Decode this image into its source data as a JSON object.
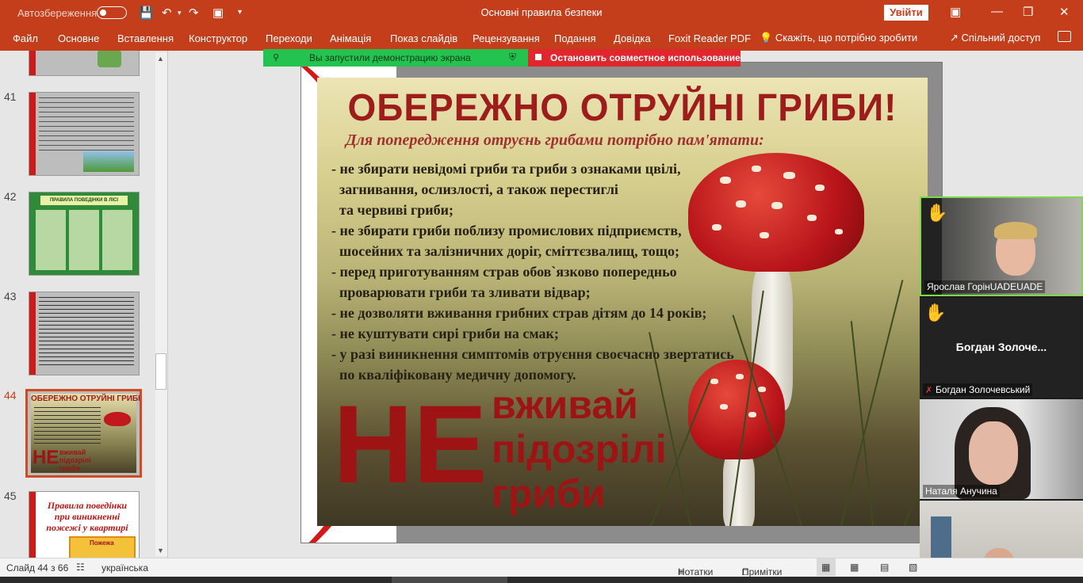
{
  "titlebar": {
    "autosave_label": "Автозбереження",
    "doc_title": "Основні правила безпеки",
    "signin_label": "Увійти"
  },
  "ribbon": {
    "tabs": [
      "Файл",
      "Основне",
      "Вставлення",
      "Конструктор",
      "Переходи",
      "Анімація",
      "Показ слайдів",
      "Рецензування",
      "Подання",
      "Довідка",
      "Foxit Reader PDF"
    ],
    "tell_me": "Скажіть, що потрібно зробити",
    "share": "Спільний доступ"
  },
  "share_notice": {
    "started": "Вы запустили демонстрацию экрана",
    "stop": "Остановить совместное использование"
  },
  "thumbnails": {
    "numbers": [
      "41",
      "42",
      "43",
      "44",
      "45"
    ],
    "active": "44",
    "slide44_title": "ОБЕРЕЖНО ОТРУЙНІ ГРИБИ!",
    "slide44_ne": "НЕ",
    "slide44_words": [
      "вживай",
      "підозрілі",
      "гриби"
    ],
    "slide42_title": "ПРАВИЛА ПОВЕДІНКИ В ЛІСІ",
    "slide45_title": "Правила поведінки при виникненні пожежі у квартирі",
    "slide45_badge": "Пожежа"
  },
  "slide": {
    "title": "ОБЕРЕЖНО ОТРУЙНІ ГРИБИ!",
    "subtitle": "Для попередження отруєнь грибами потрібно пам'ятати:",
    "lines": [
      "- не збирати невідомі гриби та гриби з ознаками цвілі,",
      "  загнивання, ослизлості, а також перестиглі",
      "  та червиві гриби;",
      "- не збирати гриби поблизу промислових  підприємств,",
      "  шосейних та залізничних доріг, сміттєзвалищ, тощо;",
      "- перед приготуванням страв обов`язково попередньо",
      "  проварювати гриби та зливати відвар;",
      "- не дозволяти вживання грибних страв дітям до 14 років;",
      "- не куштувати сирі гриби на смак;",
      "- у разі виникнення симптомів отруєння своєчасно звертатись",
      "  по кваліфіковану медичну допомогу."
    ],
    "ne": "НЕ",
    "ne_words": [
      "вживай",
      "підозрілі",
      "гриби"
    ]
  },
  "participants": [
    {
      "name": "Ярослав ГорінUADEUADE",
      "hand": true,
      "video": true
    },
    {
      "name": "Богдан Золочевський",
      "display": "Богдан  Золоче...",
      "hand": true,
      "video": false,
      "muted": true
    },
    {
      "name": "Наталя Анучина",
      "hand": false,
      "video": true
    },
    {
      "name": "",
      "hand": false,
      "video": true
    }
  ],
  "statusbar": {
    "slide_count": "Слайд 44 з 66",
    "language": "українська",
    "notes": "Нотатки",
    "comments": "Примітки"
  },
  "colors": {
    "accent": "#c43e1c",
    "share_green": "#24c350",
    "share_red": "#e0272e",
    "slide_red": "#9e1414"
  }
}
